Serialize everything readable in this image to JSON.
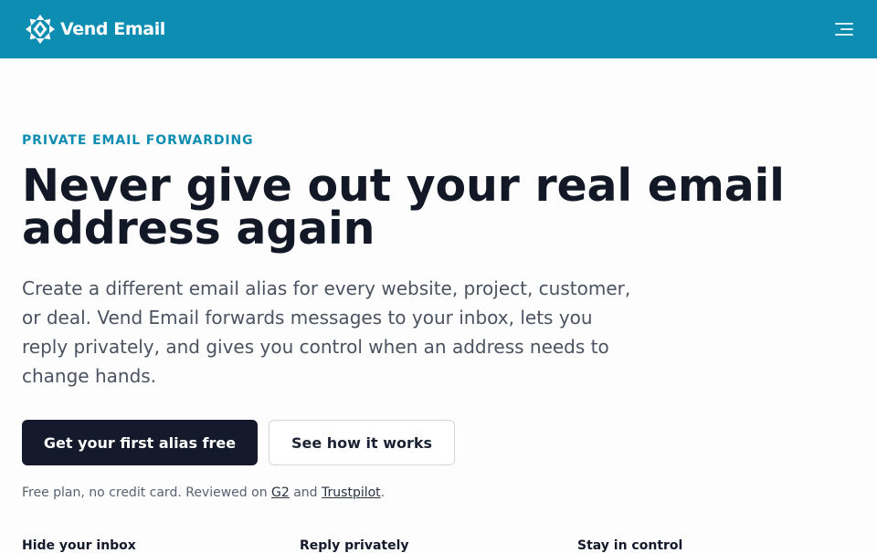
{
  "header": {
    "brand_name": "Vend Email",
    "logo_icon": "vend-email-logo",
    "menu_icon": "menu-icon",
    "background": "#0e8db3"
  },
  "hero": {
    "eyebrow": "PRIVATE EMAIL FORWARDING",
    "headline_line1": "Never give out your real email",
    "headline_line2": "address again",
    "lede": "Create a different email alias for every website, project, customer, or deal. Vend Email forwards messages to your inbox, lets you reply privately, and gives you control when an address needs to change hands.",
    "primary_cta": "Get your first alias free",
    "secondary_cta": "See how it works",
    "note_prefix": "Free plan, no credit card. Reviewed on ",
    "note_link1": "G2",
    "note_mid": " and ",
    "note_link2": "Trustpilot",
    "note_suffix": "."
  },
  "features": [
    {
      "title": "Hide your inbox"
    },
    {
      "title": "Reply privately"
    },
    {
      "title": "Stay in control"
    }
  ],
  "colors": {
    "accent": "#0e8db3",
    "primary_button": "#141a2b",
    "text": "#121826"
  }
}
